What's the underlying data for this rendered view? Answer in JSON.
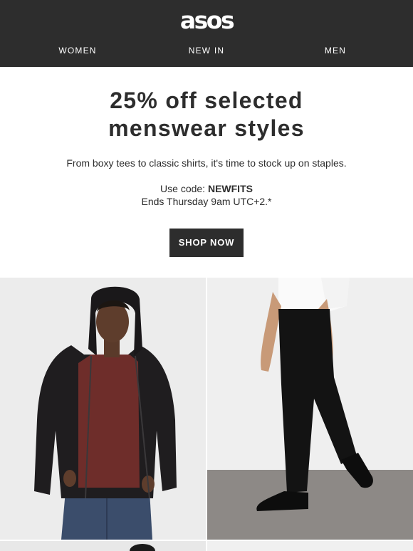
{
  "header": {
    "logo_text": "asos",
    "nav": [
      {
        "label": "WOMEN"
      },
      {
        "label": "NEW IN"
      },
      {
        "label": "MEN"
      }
    ]
  },
  "hero": {
    "headline_line1": "25% off selected",
    "headline_line2": "menswear styles",
    "subtitle": "From boxy tees to classic shirts, it's time to stock up on staples.",
    "code_prefix": "Use code: ",
    "code": "NEWFITS",
    "ends_text": "Ends Thursday 9am UTC+2.*",
    "cta_label": "SHOP NOW"
  },
  "colors": {
    "header_bg": "#2d2d2d",
    "text": "#2d2d2d",
    "cta_bg": "#2d2d2d",
    "cta_text": "#ffffff"
  }
}
